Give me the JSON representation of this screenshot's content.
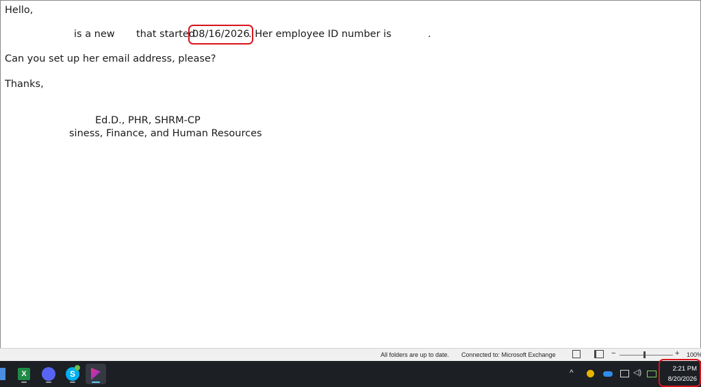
{
  "email": {
    "greeting": "Hello,",
    "line1_a": "is a new",
    "line1_b": "that started",
    "line1_date": "08/16/2026",
    "line1_c": ". Her employee ID number is",
    "line1_end": ".",
    "request": "Can you set up her email address, please?",
    "signoff": "Thanks,",
    "sig_credentials": "Ed.D., PHR, SHRM-CP",
    "sig_department": "siness, Finance, and Human Resources"
  },
  "statusbar": {
    "sync_status": "All folders are up to date.",
    "connection": "Connected to: Microsoft Exchange",
    "zoom_minus": "−",
    "zoom_plus": "+",
    "zoom_level": "100%",
    "zoom_fraction": 0.5
  },
  "taskbar": {
    "apps": [
      {
        "name": "excel",
        "color": "#1f8a46"
      },
      {
        "name": "discord",
        "color": "#5865f2"
      },
      {
        "name": "skype",
        "color": "#00aff0"
      },
      {
        "name": "app",
        "color": "#8b2ad8"
      }
    ],
    "time": "2:21 PM",
    "date": "8/20/2026"
  },
  "colors": {
    "highlight": "#d8131a",
    "taskbar": "#1c1f24"
  }
}
